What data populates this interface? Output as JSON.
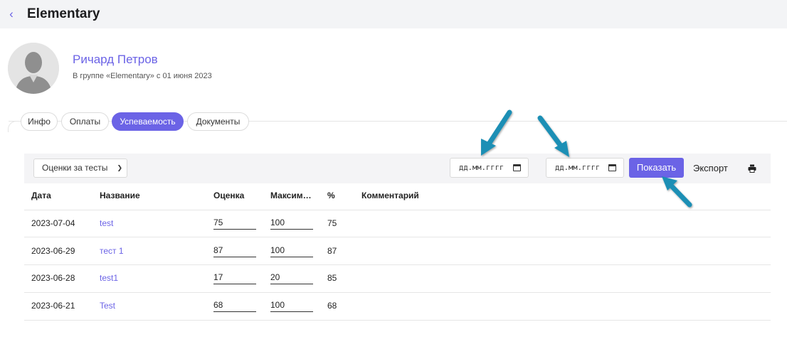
{
  "header": {
    "back_icon": "chevron-left-icon",
    "title": "Elementary"
  },
  "profile": {
    "name": "Ричард Петров",
    "subtitle": "В группе «Elementary» с 01 июня 2023",
    "avatar_icon": "user-avatar-icon"
  },
  "tabs": [
    {
      "label": "Инфо",
      "active": false
    },
    {
      "label": "Оплаты",
      "active": false
    },
    {
      "label": "Успеваемость",
      "active": true
    },
    {
      "label": "Документы",
      "active": false
    }
  ],
  "toolbar": {
    "select_value": "Оценки за тесты",
    "date_from_placeholder": "дд.мм.гггг",
    "date_to_placeholder": "дд.мм.гггг",
    "show_label": "Показать",
    "export_label": "Экспорт",
    "print_icon": "print-icon"
  },
  "table": {
    "headers": [
      "Дата",
      "Название",
      "Оценка",
      "Максим…",
      "%",
      "Комментарий"
    ],
    "rows": [
      {
        "date": "2023-07-04",
        "name": "test",
        "score": "75",
        "max": "100",
        "percent": "75",
        "comment": ""
      },
      {
        "date": "2023-06-29",
        "name": "тест 1",
        "score": "87",
        "max": "100",
        "percent": "87",
        "comment": ""
      },
      {
        "date": "2023-06-28",
        "name": "test1",
        "score": "17",
        "max": "20",
        "percent": "85",
        "comment": ""
      },
      {
        "date": "2023-06-21",
        "name": "Test",
        "score": "68",
        "max": "100",
        "percent": "68",
        "comment": ""
      }
    ]
  },
  "colors": {
    "accent": "#6b63e6",
    "annotation_arrow": "#1a8fb5"
  }
}
